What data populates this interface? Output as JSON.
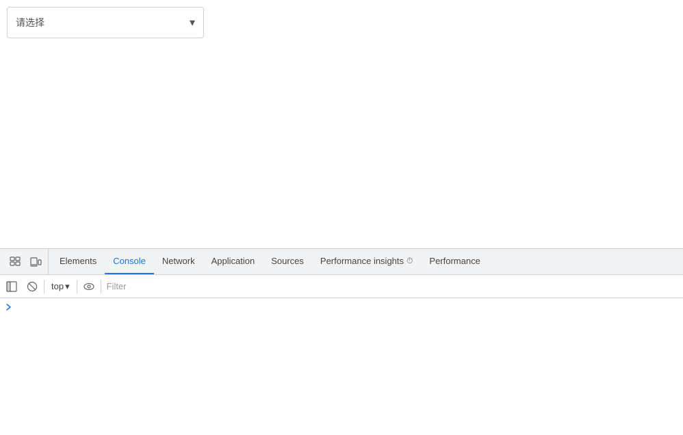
{
  "main": {
    "select": {
      "placeholder": "请选择",
      "arrow": "▾"
    }
  },
  "devtools": {
    "tabs": [
      {
        "id": "elements",
        "label": "Elements",
        "active": false
      },
      {
        "id": "console",
        "label": "Console",
        "active": true
      },
      {
        "id": "network",
        "label": "Network",
        "active": false
      },
      {
        "id": "application",
        "label": "Application",
        "active": false
      },
      {
        "id": "sources",
        "label": "Sources",
        "active": false
      },
      {
        "id": "performance-insights",
        "label": "Performance insights",
        "active": false,
        "has_icon": true
      },
      {
        "id": "performance",
        "label": "Performance",
        "active": false
      }
    ],
    "console_bar": {
      "top_label": "top",
      "dropdown_arrow": "▾",
      "filter_placeholder": "Filter"
    },
    "chevron": "›"
  },
  "colors": {
    "active_tab": "#1a73e8",
    "icon": "#5f6368",
    "border": "#d0d0d0",
    "bg_tabs": "#f1f3f4",
    "bg_content": "#ffffff"
  }
}
